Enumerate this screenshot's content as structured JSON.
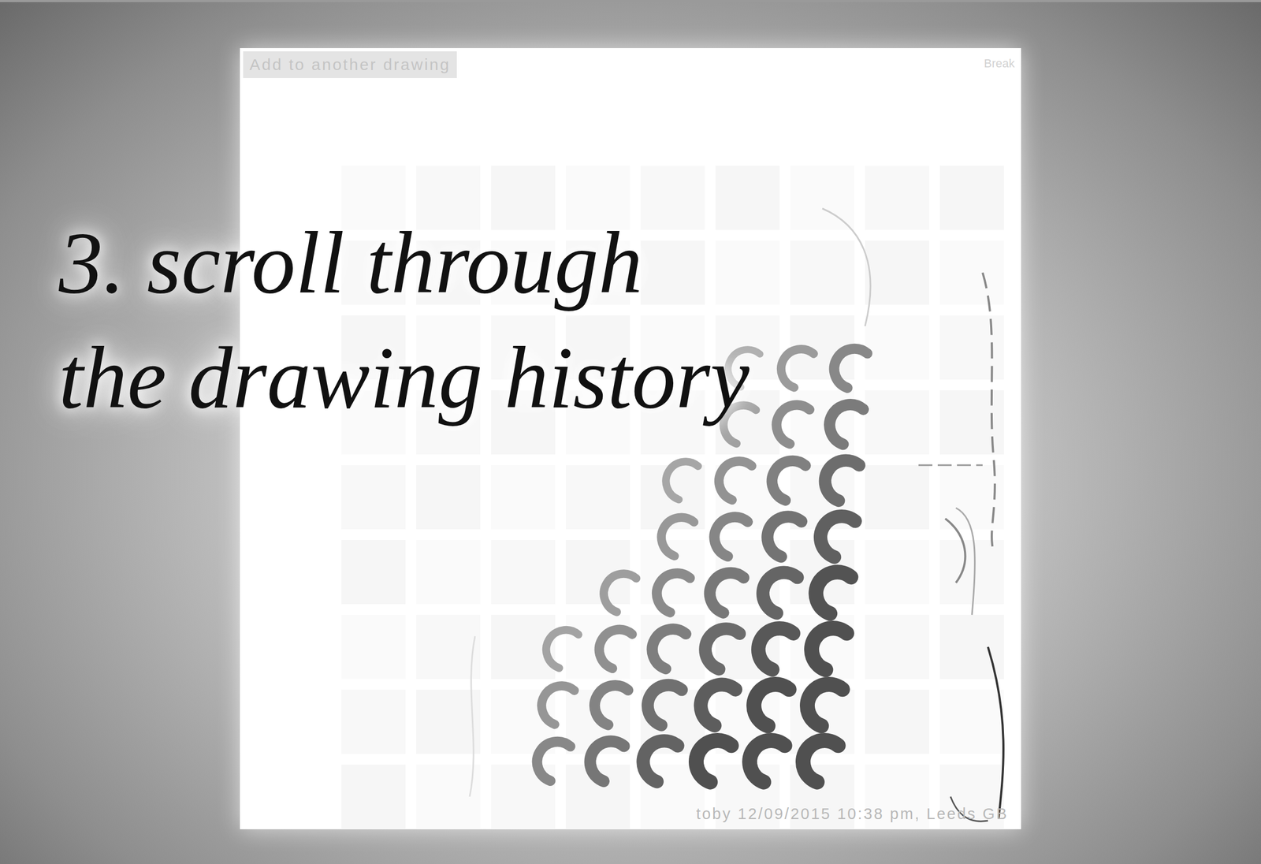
{
  "canvas": {
    "add_button": "Add to another drawing",
    "break_button": "Break",
    "caption": "toby 12/09/2015 10:38 pm, Leeds GB"
  },
  "overlay": {
    "lines": [
      "3. scroll through",
      "the drawing history"
    ]
  }
}
